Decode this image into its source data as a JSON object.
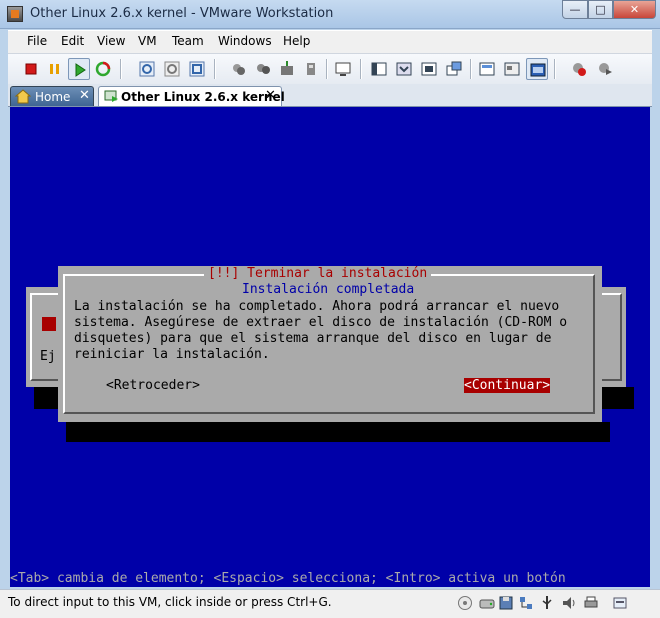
{
  "window": {
    "title": "Other Linux 2.6.x kernel - VMware Workstation"
  },
  "menu": [
    "File",
    "Edit",
    "View",
    "VM",
    "Team",
    "Windows",
    "Help"
  ],
  "tabs": {
    "home": "Home",
    "vm": "Other Linux 2.6.x kernel"
  },
  "installer": {
    "background_prefix": "Ej",
    "title": "[!!] Terminar la instalación",
    "subtitle": "Instalación completada",
    "lines": [
      "La instalación se ha completado. Ahora podrá arrancar el nuevo",
      "sistema. Asegúrese de extraer el disco de instalación (CD-ROM o",
      "disquetes) para que el sistema arranque del disco en lugar de",
      "reiniciar la instalación."
    ],
    "back_button": "<Retroceder>",
    "continue_button": "<Continuar>",
    "help_line": "<Tab> cambia de elemento; <Espacio> selecciona; <Intro> activa un botón"
  },
  "status": {
    "text": "To direct input to this VM, click inside or press Ctrl+G."
  },
  "colors": {
    "console_bg": "#0000a8",
    "dialog_bg": "#aaaaaa",
    "accent_red": "#a80000"
  }
}
